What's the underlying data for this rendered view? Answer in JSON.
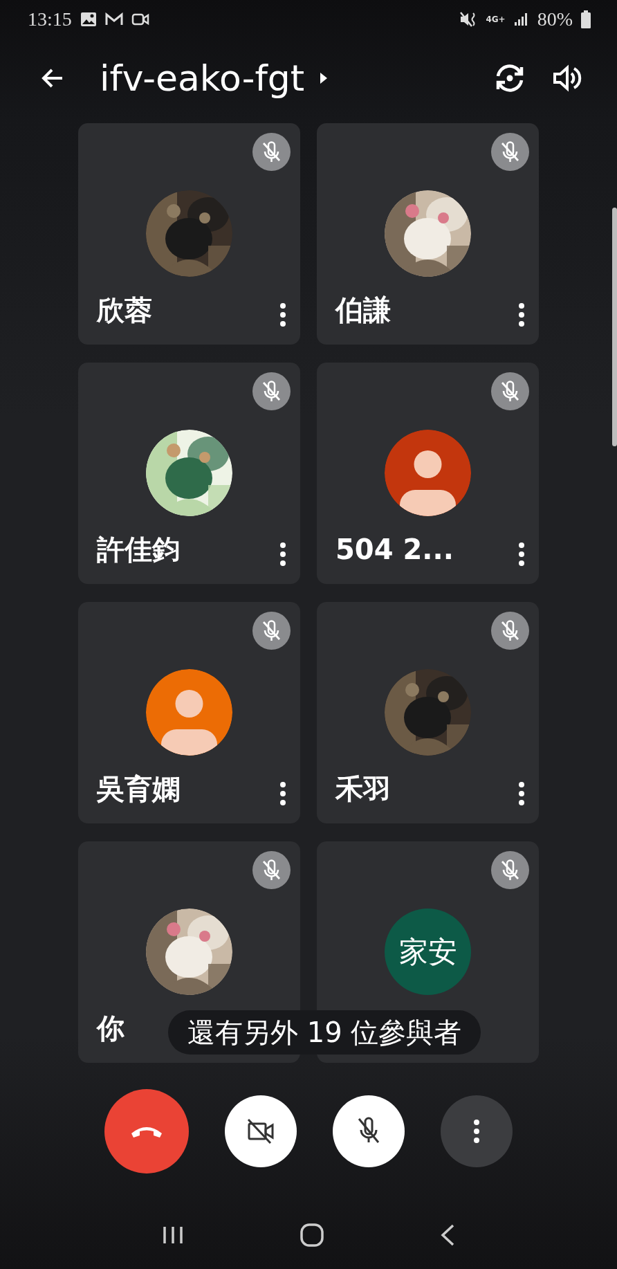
{
  "status_bar": {
    "time": "13:15",
    "network": "4G+",
    "battery": "80%"
  },
  "header": {
    "title": "ifv-eako-fgt"
  },
  "participants": [
    {
      "name": "欣蓉",
      "muted": true
    },
    {
      "name": "伯謙",
      "muted": true
    },
    {
      "name": "許佳鈞",
      "muted": true
    },
    {
      "name": "504 2...",
      "muted": true,
      "avatar": {
        "kind": "default",
        "color": "#c3360d"
      }
    },
    {
      "name": "吳育嫻",
      "muted": true,
      "avatar": {
        "kind": "default",
        "color": "#ec6c05"
      }
    },
    {
      "name": "禾羽",
      "muted": true
    },
    {
      "name": "你",
      "muted": true
    },
    {
      "muted": true,
      "avatar": {
        "kind": "initials",
        "text": "家安",
        "color": "#0d5a47"
      }
    }
  ],
  "more_participants": "還有另外 19 位參與者",
  "controls": [
    {
      "kind": "hangup"
    },
    {
      "kind": "camera",
      "on": false
    },
    {
      "kind": "mic",
      "on": false
    },
    {
      "kind": "more"
    }
  ]
}
